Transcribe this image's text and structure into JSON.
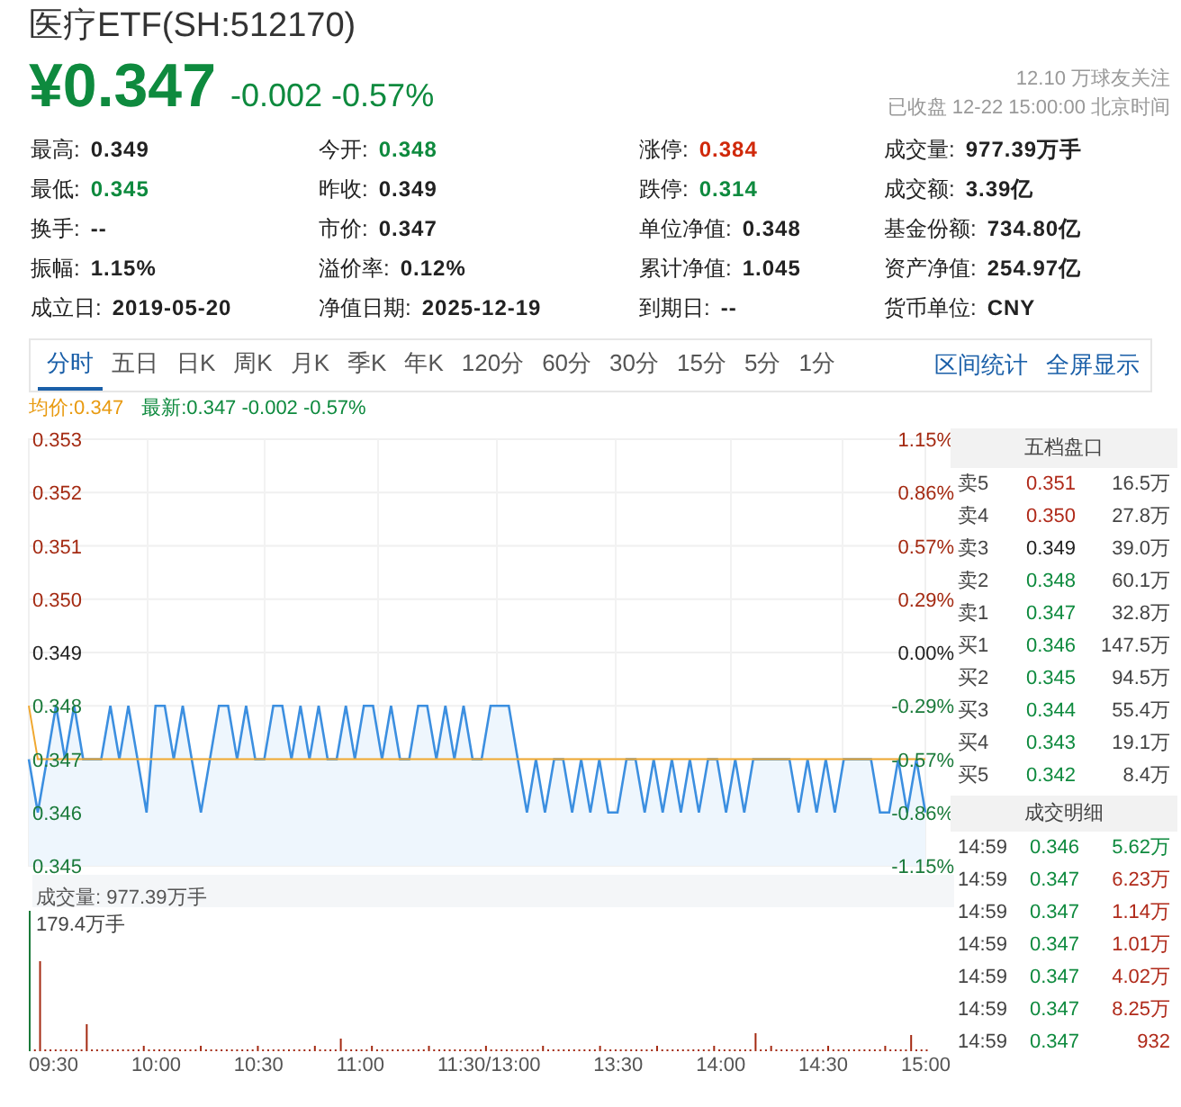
{
  "header": {
    "title": "医疗ETF(SH:512170)",
    "price": "¥0.347",
    "change": "-0.002 -0.57%",
    "followers": "12.10 万球友关注",
    "status": "已收盘 12-22 15:00:00 北京时间"
  },
  "stats": [
    [
      {
        "label": "最高:",
        "value": "0.349",
        "color": "#222222"
      },
      {
        "label": "今开:",
        "value": "0.348",
        "color": "#0e8a3e"
      },
      {
        "label": "涨停:",
        "value": "0.384",
        "color": "#d0290a"
      },
      {
        "label": "成交量:",
        "value": "977.39万手",
        "color": "#222222"
      }
    ],
    [
      {
        "label": "最低:",
        "value": "0.345",
        "color": "#0e8a3e"
      },
      {
        "label": "昨收:",
        "value": "0.349",
        "color": "#222222"
      },
      {
        "label": "跌停:",
        "value": "0.314",
        "color": "#0e8a3e"
      },
      {
        "label": "成交额:",
        "value": "3.39亿",
        "color": "#222222"
      }
    ],
    [
      {
        "label": "换手:",
        "value": "--",
        "color": "#222222"
      },
      {
        "label": "市价:",
        "value": "0.347",
        "color": "#222222"
      },
      {
        "label": "单位净值:",
        "value": "0.348",
        "color": "#222222"
      },
      {
        "label": "基金份额:",
        "value": "734.80亿",
        "color": "#222222"
      }
    ],
    [
      {
        "label": "振幅:",
        "value": "1.15%",
        "color": "#222222"
      },
      {
        "label": "溢价率:",
        "value": "0.12%",
        "color": "#222222"
      },
      {
        "label": "累计净值:",
        "value": "1.045",
        "color": "#222222"
      },
      {
        "label": "资产净值:",
        "value": "254.97亿",
        "color": "#222222"
      }
    ],
    [
      {
        "label": "成立日:",
        "value": "2019-05-20",
        "color": "#222222"
      },
      {
        "label": "净值日期:",
        "value": "2025-12-19",
        "color": "#222222"
      },
      {
        "label": "到期日:",
        "value": "--",
        "color": "#222222"
      },
      {
        "label": "货币单位:",
        "value": "CNY",
        "color": "#222222"
      }
    ]
  ],
  "tabs": [
    {
      "label": "分时",
      "selected": true
    },
    {
      "label": "五日",
      "selected": false
    },
    {
      "label": "日K",
      "selected": false
    },
    {
      "label": "周K",
      "selected": false
    },
    {
      "label": "月K",
      "selected": false
    },
    {
      "label": "季K",
      "selected": false
    },
    {
      "label": "年K",
      "selected": false
    },
    {
      "label": "120分",
      "selected": false
    },
    {
      "label": "60分",
      "selected": false
    },
    {
      "label": "30分",
      "selected": false
    },
    {
      "label": "15分",
      "selected": false
    },
    {
      "label": "5分",
      "selected": false
    },
    {
      "label": "1分",
      "selected": false
    }
  ],
  "links": [
    "区间统计",
    "全屏显示"
  ],
  "legend": {
    "average": "均价:0.347",
    "latest": "最新:0.347 -0.002 -0.57%"
  },
  "price_chart": {
    "right_axis": [
      "1.15%",
      "0.86%",
      "0.57%",
      "0.29%",
      "0.00%",
      "-0.29%",
      "-0.57%",
      "-0.86%",
      "-1.15%"
    ],
    "chart_data": {
      "type": "line",
      "grid": true,
      "ylim": [
        0.345,
        0.353
      ],
      "yticks": [
        {
          "value": 0.353,
          "label": "0.353"
        },
        {
          "value": 0.352,
          "label": "0.352"
        },
        {
          "value": 0.351,
          "label": "0.351"
        },
        {
          "value": 0.35,
          "label": "0.350"
        },
        {
          "value": 0.349,
          "label": "0.349"
        },
        {
          "value": 0.348,
          "label": "0.348"
        },
        {
          "value": 0.347,
          "label": "0.347"
        },
        {
          "value": 0.346,
          "label": "0.346"
        },
        {
          "value": 0.345,
          "label": "0.345"
        }
      ],
      "series": [
        {
          "color": "#3c8fe0",
          "values": [
            0.347,
            0.346,
            0.347,
            0.348,
            0.347,
            0.348,
            0.347,
            0.347,
            0.347,
            0.348,
            0.347,
            0.348,
            0.347,
            0.346,
            0.348,
            0.348,
            0.347,
            0.348,
            0.347,
            0.346,
            0.347,
            0.348,
            0.348,
            0.347,
            0.348,
            0.347,
            0.347,
            0.348,
            0.348,
            0.347,
            0.348,
            0.347,
            0.348,
            0.347,
            0.347,
            0.348,
            0.347,
            0.348,
            0.348,
            0.347,
            0.348,
            0.347,
            0.347,
            0.348,
            0.348,
            0.347,
            0.348,
            0.347,
            0.348,
            0.347,
            0.347,
            0.348,
            0.348,
            0.348,
            0.347,
            0.346,
            0.347,
            0.346,
            0.347,
            0.347,
            0.346,
            0.347,
            0.346,
            0.347,
            0.346,
            0.346,
            0.347,
            0.347,
            0.346,
            0.347,
            0.346,
            0.347,
            0.346,
            0.347,
            0.346,
            0.347,
            0.347,
            0.346,
            0.347,
            0.346,
            0.347,
            0.347,
            0.347,
            0.347,
            0.347,
            0.346,
            0.347,
            0.346,
            0.347,
            0.346,
            0.347,
            0.347,
            0.347,
            0.347,
            0.346,
            0.346,
            0.347,
            0.346,
            0.347,
            0.346
          ]
        },
        {
          "color": "#f0a830",
          "values": [
            0.348,
            0.347,
            0.347,
            0.347,
            0.347,
            0.347,
            0.347,
            0.347,
            0.347,
            0.347,
            0.347,
            0.347,
            0.347,
            0.347,
            0.347,
            0.347,
            0.347,
            0.347,
            0.347,
            0.347,
            0.347,
            0.347,
            0.347,
            0.347,
            0.347,
            0.347,
            0.347,
            0.347,
            0.347,
            0.347,
            0.347,
            0.347,
            0.347,
            0.347,
            0.347,
            0.347,
            0.347,
            0.347,
            0.347,
            0.347,
            0.347,
            0.347,
            0.347,
            0.347,
            0.347,
            0.347,
            0.347,
            0.347,
            0.347,
            0.347,
            0.347,
            0.347,
            0.347,
            0.347,
            0.347,
            0.347,
            0.347,
            0.347,
            0.347,
            0.347,
            0.347,
            0.347,
            0.347,
            0.347,
            0.347,
            0.347,
            0.347,
            0.347,
            0.347,
            0.347,
            0.347,
            0.347,
            0.347,
            0.347,
            0.347,
            0.347,
            0.347,
            0.347,
            0.347,
            0.347,
            0.347,
            0.347,
            0.347,
            0.347,
            0.347,
            0.347,
            0.347,
            0.347,
            0.347,
            0.347,
            0.347,
            0.347,
            0.347,
            0.347,
            0.347,
            0.347,
            0.347,
            0.347,
            0.347,
            0.347
          ]
        }
      ]
    }
  },
  "volume": {
    "title": "成交量: 977.39万手",
    "max_label": "179.4万手",
    "times": [
      "09:30",
      "10:00",
      "10:30",
      "11:00",
      "11:30/13:00",
      "13:30",
      "14:00",
      "14:30",
      "15:00"
    ]
  },
  "order_book": {
    "title": "五档盘口",
    "rows": [
      {
        "label": "卖5",
        "price": "0.351",
        "volume": "16.5万",
        "color": "#b02a1a"
      },
      {
        "label": "卖4",
        "price": "0.350",
        "volume": "27.8万",
        "color": "#b02a1a"
      },
      {
        "label": "卖3",
        "price": "0.349",
        "volume": "39.0万",
        "color": "#222222"
      },
      {
        "label": "卖2",
        "price": "0.348",
        "volume": "60.1万",
        "color": "#0e8a3e"
      },
      {
        "label": "卖1",
        "price": "0.347",
        "volume": "32.8万",
        "color": "#0e8a3e"
      },
      {
        "label": "买1",
        "price": "0.346",
        "volume": "147.5万",
        "color": "#0e8a3e"
      },
      {
        "label": "买2",
        "price": "0.345",
        "volume": "94.5万",
        "color": "#0e8a3e"
      },
      {
        "label": "买3",
        "price": "0.344",
        "volume": "55.4万",
        "color": "#0e8a3e"
      },
      {
        "label": "买4",
        "price": "0.343",
        "volume": "19.1万",
        "color": "#0e8a3e"
      },
      {
        "label": "买5",
        "price": "0.342",
        "volume": "8.4万",
        "color": "#0e8a3e"
      }
    ]
  },
  "trades": {
    "title": "成交明细",
    "rows": [
      {
        "time": "14:59",
        "price": "0.346",
        "volume": "5.62万",
        "color": "#0e8a3e"
      },
      {
        "time": "14:59",
        "price": "0.347",
        "volume": "6.23万",
        "color": "#b02a1a"
      },
      {
        "time": "14:59",
        "price": "0.347",
        "volume": "1.14万",
        "color": "#b02a1a"
      },
      {
        "time": "14:59",
        "price": "0.347",
        "volume": "1.01万",
        "color": "#b02a1a"
      },
      {
        "time": "14:59",
        "price": "0.347",
        "volume": "4.02万",
        "color": "#b02a1a"
      },
      {
        "time": "14:59",
        "price": "0.347",
        "volume": "8.25万",
        "color": "#b02a1a"
      },
      {
        "time": "14:59",
        "price": "0.347",
        "volume": "932",
        "color": "#b02a1a"
      }
    ]
  }
}
